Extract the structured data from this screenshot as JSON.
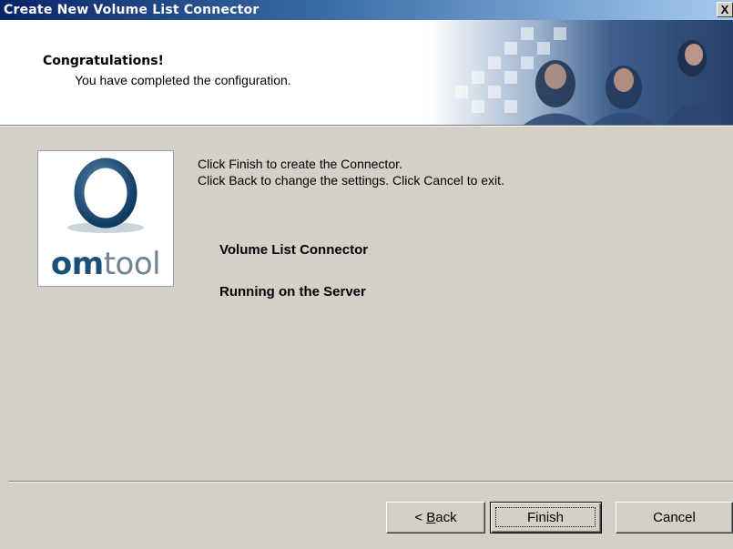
{
  "window": {
    "title": "Create New Volume List Connector",
    "close_glyph": "X"
  },
  "header": {
    "title": "Congratulations!",
    "subtitle": "You have completed the configuration."
  },
  "logo": {
    "brand_prefix": "om",
    "brand_suffix": "tool",
    "colors": {
      "ring": "#1a4f7a",
      "text_bold": "#1a4f7a",
      "text_light": "#6f8390"
    }
  },
  "content": {
    "instruction_line1": "Click Finish to create the Connector.",
    "instruction_line2": "Click Back to change the settings. Click Cancel to exit.",
    "summary_line1": "Volume List Connector",
    "summary_line2": "Running on the Server"
  },
  "buttons": {
    "back_prefix": "< ",
    "back_accel": "B",
    "back_rest": "ack",
    "finish": "Finish",
    "cancel": "Cancel"
  },
  "colors": {
    "titlebar_start": "#0a246a",
    "titlebar_end": "#a6caf0",
    "dialog_bg": "#d4d0c8"
  }
}
